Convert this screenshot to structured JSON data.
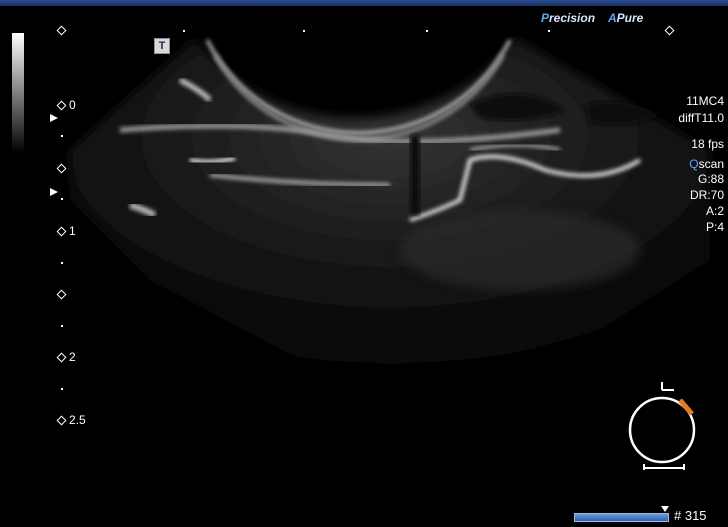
{
  "brand": {
    "precision": {
      "initial": "P",
      "rest": "recision"
    },
    "pure": {
      "initial": "A",
      "rest": "Pure"
    }
  },
  "toolbar": {
    "orientation_button": "T"
  },
  "depth_scale": {
    "labels": [
      "0",
      "1",
      "2",
      "2.5"
    ]
  },
  "parameters": {
    "transducer": "11MC4",
    "mode": "diffT11.0",
    "frame_rate": "18 fps",
    "qscan": {
      "initial": "Q",
      "rest": "scan"
    },
    "gain": "G:88",
    "dynamic_range": "DR:70",
    "a": "A:2",
    "p": "P:4"
  },
  "footer": {
    "frame_count": "# 315"
  },
  "colors": {
    "accent": "#5aa6ff",
    "probe_mark": "#e07b22",
    "topbar": "#16305f"
  }
}
